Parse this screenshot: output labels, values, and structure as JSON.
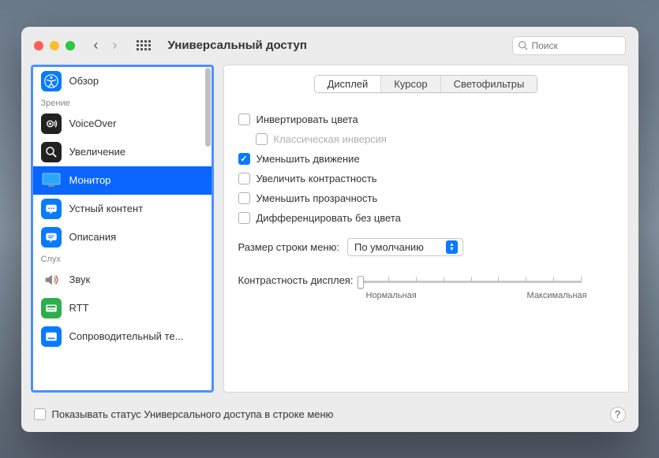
{
  "window": {
    "title": "Универсальный доступ"
  },
  "search": {
    "placeholder": "Поиск"
  },
  "sidebar": {
    "section_vision": "Зрение",
    "section_hearing": "Слух",
    "items": {
      "overview": "Обзор",
      "voiceover": "VoiceOver",
      "zoom": "Увеличение",
      "monitor": "Монитор",
      "speech": "Устный контент",
      "descriptions": "Описания",
      "sound": "Звук",
      "rtt": "RTT",
      "subtitles": "Сопроводительный те..."
    }
  },
  "tabs": {
    "display": "Дисплей",
    "cursor": "Курсор",
    "filters": "Светофильтры"
  },
  "checks": {
    "invert": "Инвертировать цвета",
    "classic_inversion": "Классическая инверсия",
    "reduce_motion": "Уменьшить движение",
    "increase_contrast": "Увеличить контрастность",
    "reduce_transparency": "Уменьшить прозрачность",
    "diff_without_color": "Дифференцировать без цвета"
  },
  "menu_bar_size": {
    "label": "Размер строки меню:",
    "value": "По умолчанию"
  },
  "contrast": {
    "label": "Контрастность дисплея:",
    "min": "Нормальная",
    "max": "Максимальная"
  },
  "footer": {
    "show_status": "Показывать статус Универсального доступа в строке меню"
  }
}
